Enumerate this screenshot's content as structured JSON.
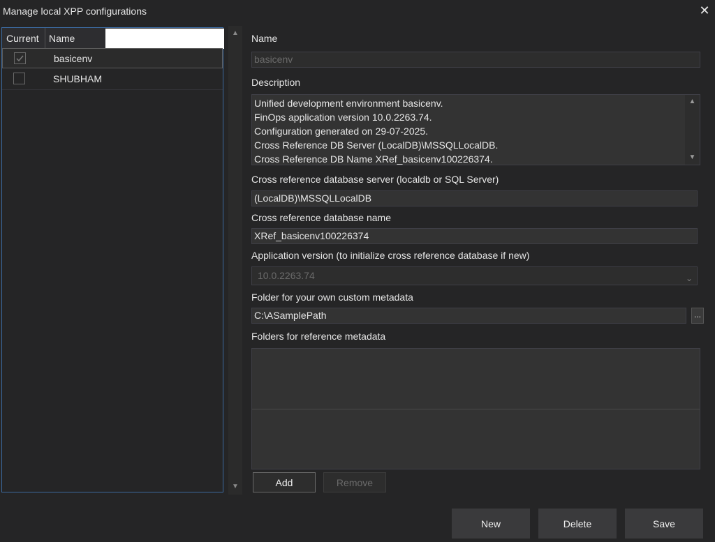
{
  "window": {
    "title": "Manage local XPP configurations",
    "close_glyph": "✕"
  },
  "list": {
    "columns": {
      "current": "Current",
      "name": "Name"
    },
    "filter_value": "",
    "rows": [
      {
        "name": "basicenv",
        "current": true,
        "selected": true
      },
      {
        "name": "SHUBHAM",
        "current": false,
        "selected": false
      }
    ]
  },
  "form": {
    "name_label": "Name",
    "name_value": "basicenv",
    "description_label": "Description",
    "description_lines": [
      "Unified development environment basicenv.",
      "FinOps application version 10.0.2263.74.",
      "Configuration generated on 29-07-2025.",
      "Cross Reference DB Server (LocalDB)\\MSSQLLocalDB.",
      "Cross Reference DB Name XRef_basicenv100226374."
    ],
    "xref_server_label": "Cross reference database server (localdb or SQL Server)",
    "xref_server_value": "(LocalDB)\\MSSQLLocalDB",
    "xref_name_label": "Cross reference database name",
    "xref_name_value": "XRef_basicenv100226374",
    "app_version_label": "Application version (to initialize cross reference database if new)",
    "app_version_value": "10.0.2263.74",
    "custom_folder_label": "Folder for your own custom metadata",
    "custom_folder_value": "C:\\ASamplePath",
    "browse_label": "...",
    "ref_folders_label": "Folders for reference metadata",
    "add_label": "Add",
    "remove_label": "Remove"
  },
  "footer": {
    "new_label": "New",
    "delete_label": "Delete",
    "save_label": "Save"
  },
  "icons": {
    "close": "close-icon",
    "checkbox_checked": "checkmark-icon",
    "scroll_up": "triangle-up-icon",
    "scroll_down": "triangle-down-icon",
    "dropdown": "chevron-down-icon"
  },
  "colors": {
    "background": "#252526",
    "accent_border": "#3c6aa0",
    "field_bg": "#333333",
    "button_bg": "#3a3a3c"
  }
}
